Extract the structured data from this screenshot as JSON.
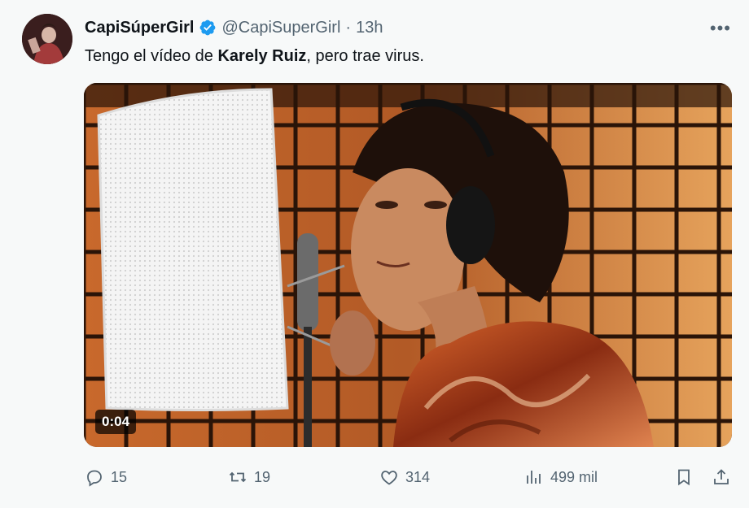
{
  "tweet": {
    "display_name": "CapiSúperGirl",
    "handle": "@CapiSuperGirl",
    "separator": "·",
    "time": "13h",
    "more_label": "•••",
    "text_before": "Tengo el vídeo de ",
    "text_bold": "Karely Ruiz",
    "text_after": ", pero trae virus.",
    "avatar_icon": "user-avatar",
    "verified_icon": "verified-badge-icon",
    "colors": {
      "verified": "#1d9bf0",
      "muted": "#536471",
      "text": "#0f1419"
    }
  },
  "media": {
    "type": "video",
    "duration": "0:04"
  },
  "actions": {
    "replies": {
      "icon": "reply-icon",
      "count": "15"
    },
    "retweets": {
      "icon": "retweet-icon",
      "count": "19"
    },
    "likes": {
      "icon": "heart-icon",
      "count": "314"
    },
    "views": {
      "icon": "views-icon",
      "count": "499 mil"
    },
    "bookmark": {
      "icon": "bookmark-icon"
    },
    "share": {
      "icon": "share-icon"
    }
  }
}
